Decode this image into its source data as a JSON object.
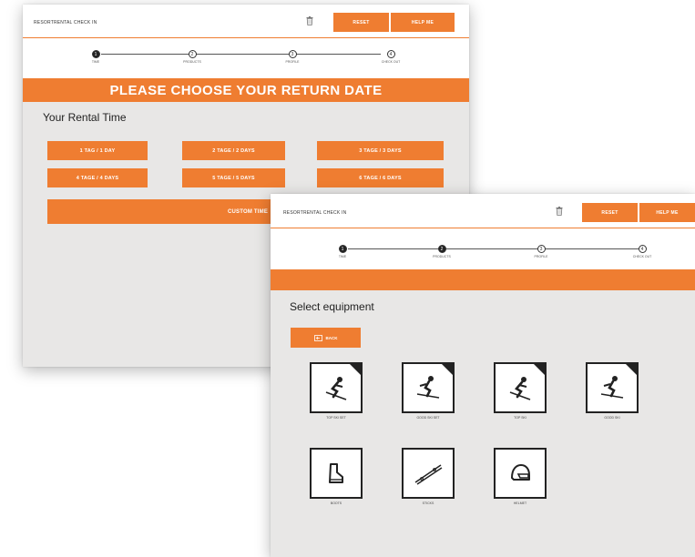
{
  "colors": {
    "accent": "#ef7d31",
    "panel": "#e8e7e6",
    "dark": "#222222"
  },
  "screen1": {
    "brand": "RESORTRENTAL CHECK IN",
    "reset": "RESET",
    "help": "HELP ME",
    "steps": [
      {
        "num": "1",
        "label": "TIME"
      },
      {
        "num": "2",
        "label": "PRODUCTS"
      },
      {
        "num": "3",
        "label": "PROFILE"
      },
      {
        "num": "4",
        "label": "CHECK OUT"
      }
    ],
    "banner": "PLEASE CHOOSE YOUR RETURN DATE",
    "section_title": "Your Rental Time",
    "options": [
      "1 TAG / 1 DAY",
      "2 TAGE / 2 DAYS",
      "3 TAGE / 3 DAYS",
      "4 TAGE / 4 DAYS",
      "5 TAGE / 5 DAYS",
      "6 TAGE / 6 DAYS"
    ],
    "custom": "CUSTOM TIME"
  },
  "screen2": {
    "brand": "RESORTRENTAL CHECK IN",
    "reset": "RESET",
    "help": "HELP ME",
    "steps": [
      {
        "num": "1",
        "label": "TIME"
      },
      {
        "num": "2",
        "label": "PRODUCTS"
      },
      {
        "num": "3",
        "label": "PROFILE"
      },
      {
        "num": "4",
        "label": "CHECK OUT"
      }
    ],
    "section_title": "Select equipment",
    "back": "BACK",
    "tiles": [
      {
        "label": "TOP SKI SET",
        "icon": "skier-icon"
      },
      {
        "label": "GOOD SKI SET",
        "icon": "skier-icon"
      },
      {
        "label": "TOP SKI",
        "icon": "skier-icon"
      },
      {
        "label": "GOOD SKI",
        "icon": "skier-icon"
      },
      {
        "label": "BOOTS",
        "icon": "ski-boot-icon"
      },
      {
        "label": "STICKS",
        "icon": "ski-poles-icon"
      },
      {
        "label": "HELMET",
        "icon": "helmet-icon"
      }
    ]
  }
}
